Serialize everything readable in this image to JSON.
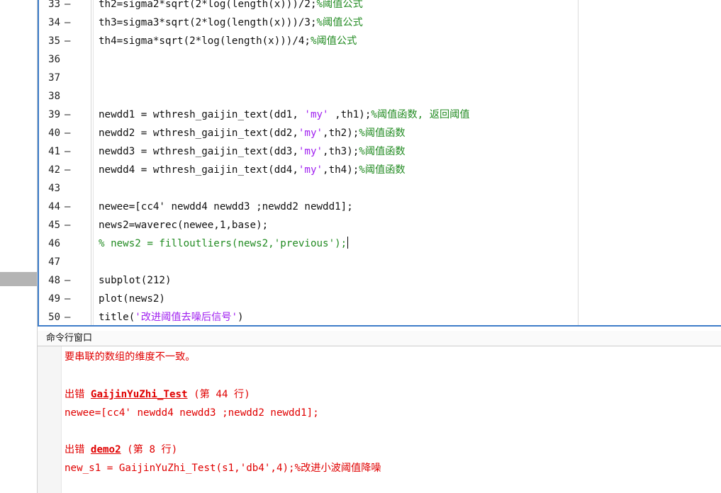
{
  "editor": {
    "lines": [
      {
        "num": "33",
        "dash": "—",
        "segs": [
          {
            "t": "th2=sigma2*sqrt(2*log(length(x)))/2;",
            "c": ""
          },
          {
            "t": "%阈值公式",
            "c": "c-comment"
          }
        ]
      },
      {
        "num": "34",
        "dash": "—",
        "segs": [
          {
            "t": "th3=sigma3*sqrt(2*log(length(x)))/3;",
            "c": ""
          },
          {
            "t": "%阈值公式",
            "c": "c-comment"
          }
        ]
      },
      {
        "num": "35",
        "dash": "—",
        "segs": [
          {
            "t": "th4=sigma*sqrt(2*log(length(x)))/4;",
            "c": ""
          },
          {
            "t": "%阈值公式",
            "c": "c-comment"
          }
        ]
      },
      {
        "num": "36",
        "dash": "",
        "segs": []
      },
      {
        "num": "37",
        "dash": "",
        "segs": []
      },
      {
        "num": "38",
        "dash": "",
        "segs": []
      },
      {
        "num": "39",
        "dash": "—",
        "segs": [
          {
            "t": "newdd1 = wthresh_gaijin_text(dd1, ",
            "c": ""
          },
          {
            "t": "'my'",
            "c": "c-string"
          },
          {
            "t": " ,th1);",
            "c": ""
          },
          {
            "t": "%阈值函数, 返回阈值",
            "c": "c-comment"
          }
        ]
      },
      {
        "num": "40",
        "dash": "—",
        "segs": [
          {
            "t": "newdd2 = wthresh_gaijin_text(dd2,",
            "c": ""
          },
          {
            "t": "'my'",
            "c": "c-string"
          },
          {
            "t": ",th2);",
            "c": ""
          },
          {
            "t": "%阈值函数",
            "c": "c-comment"
          }
        ]
      },
      {
        "num": "41",
        "dash": "—",
        "segs": [
          {
            "t": "newdd3 = wthresh_gaijin_text(dd3,",
            "c": ""
          },
          {
            "t": "'my'",
            "c": "c-string"
          },
          {
            "t": ",th3);",
            "c": ""
          },
          {
            "t": "%阈值函数",
            "c": "c-comment"
          }
        ]
      },
      {
        "num": "42",
        "dash": "—",
        "segs": [
          {
            "t": "newdd4 = wthresh_gaijin_text(dd4,",
            "c": ""
          },
          {
            "t": "'my'",
            "c": "c-string"
          },
          {
            "t": ",th4);",
            "c": ""
          },
          {
            "t": "%阈值函数",
            "c": "c-comment"
          }
        ]
      },
      {
        "num": "43",
        "dash": "",
        "segs": []
      },
      {
        "num": "44",
        "dash": "—",
        "segs": [
          {
            "t": "newee=[cc4' newdd4 newdd3 ;newdd2 newdd1];",
            "c": ""
          }
        ]
      },
      {
        "num": "45",
        "dash": "—",
        "segs": [
          {
            "t": "news2=waverec(newee,1,base);",
            "c": ""
          }
        ]
      },
      {
        "num": "46",
        "dash": "",
        "segs": [
          {
            "t": "% news2 = filloutliers(news2,'previous');",
            "c": "c-comment"
          }
        ],
        "caret": true
      },
      {
        "num": "47",
        "dash": "",
        "segs": []
      },
      {
        "num": "48",
        "dash": "—",
        "segs": [
          {
            "t": "subplot(212)",
            "c": ""
          }
        ]
      },
      {
        "num": "49",
        "dash": "—",
        "segs": [
          {
            "t": "plot(news2)",
            "c": ""
          }
        ]
      },
      {
        "num": "50",
        "dash": "—",
        "segs": [
          {
            "t": "title(",
            "c": ""
          },
          {
            "t": "'改进阈值去噪后信号'",
            "c": "c-string"
          },
          {
            "t": ")",
            "c": ""
          }
        ]
      }
    ]
  },
  "command_window": {
    "title": "命令行窗口",
    "error_message": "要串联的数组的维度不一致。",
    "error1_prefix": "出错 ",
    "error1_link": "GaijinYuZhi_Test",
    "error1_loc": " (第 44 行)",
    "error1_code": "newee=[cc4' newdd4 newdd3 ;newdd2 newdd1];",
    "error2_prefix": "出错 ",
    "error2_link": "demo2",
    "error2_loc": " (第 8 行)",
    "error2_code": "new_s1 = GaijinYuZhi_Test(s1,'db4',4);%改进小波阈值降噪"
  }
}
